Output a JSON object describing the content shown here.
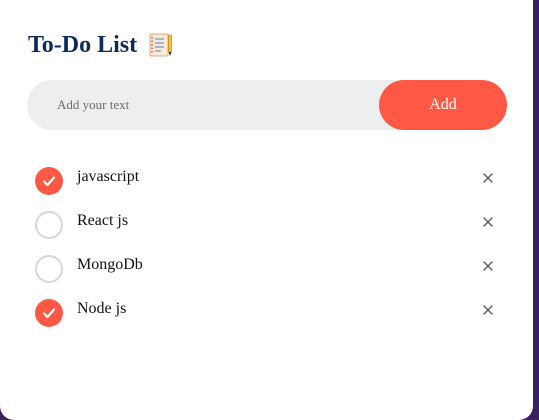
{
  "app": {
    "title": "To-Do List",
    "icon": "notebook-icon"
  },
  "input": {
    "placeholder": "Add your text",
    "value": ""
  },
  "add_button": {
    "label": "Add"
  },
  "tasks": [
    {
      "label": "javascript",
      "done": true
    },
    {
      "label": "React js",
      "done": false
    },
    {
      "label": "MongoDb",
      "done": false
    },
    {
      "label": "Node js",
      "done": true
    }
  ],
  "icons": {
    "check": "check-icon",
    "remove": "close-icon"
  },
  "colors": {
    "accent": "#ff5945",
    "title": "#0d2a5c",
    "input_bg": "#edeef0",
    "background": "#3b1f5e"
  }
}
